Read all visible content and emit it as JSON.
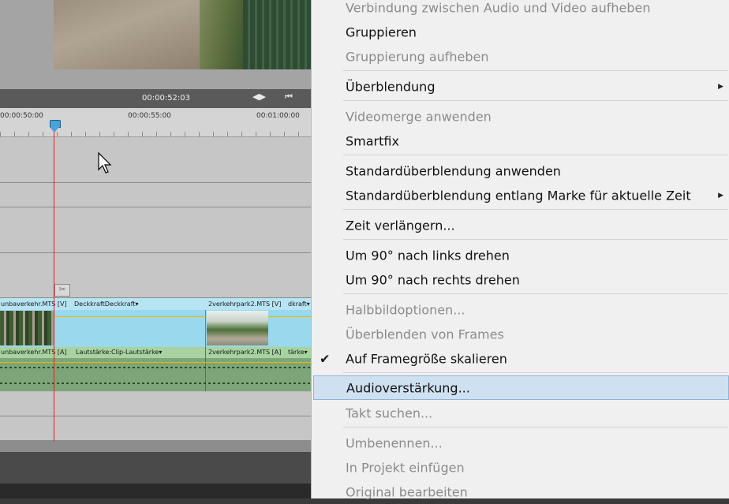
{
  "timeline": {
    "timecode": "00:00:52:03",
    "ruler_labels": [
      "00:00:50:00",
      "00:00:55:00",
      "00:01:00:00"
    ],
    "video_clip_1": "unbaverkehr.MTS [V]",
    "video_clip_1_effect": "DeckkraftDeckkraft▾",
    "video_clip_2": "2verkehrpark2.MTS [V]",
    "video_clip_2_effect": "dkraft▾",
    "audio_clip_1": "unbaverkehr.MTS [A]",
    "audio_clip_1_effect": "Lautstärke:Clip-Lautstärke▾",
    "audio_clip_2": "2verkehrpark2.MTS [A]",
    "audio_clip_2_effect": "tärke▾"
  },
  "menu": {
    "items": [
      {
        "label": "Verbindung zwischen Audio und Video aufheben",
        "disabled": true
      },
      {
        "label": "Gruppieren",
        "disabled": false
      },
      {
        "label": "Gruppierung aufheben",
        "disabled": true
      },
      {
        "label": "Überblendung",
        "disabled": false,
        "submenu": true
      },
      {
        "label": "Videomerge anwenden",
        "disabled": true
      },
      {
        "label": "Smartfix",
        "disabled": false
      },
      {
        "label": "Standardüberblendung anwenden",
        "disabled": false
      },
      {
        "label": "Standardüberblendung entlang Marke für aktuelle Zeit",
        "disabled": false,
        "submenu": true
      },
      {
        "label": "Zeit verlängern...",
        "disabled": false
      },
      {
        "label": "Um 90° nach links drehen",
        "disabled": false
      },
      {
        "label": "Um 90° nach rechts drehen",
        "disabled": false
      },
      {
        "label": "Halbbildoptionen...",
        "disabled": true
      },
      {
        "label": "Überblenden von Frames",
        "disabled": true
      },
      {
        "label": "Auf Framegröße skalieren",
        "disabled": false,
        "checked": true
      },
      {
        "label": "Audioverstärkung...",
        "disabled": false,
        "highlighted": true
      },
      {
        "label": "Takt suchen...",
        "disabled": true
      },
      {
        "label": "Umbenennen...",
        "disabled": true
      },
      {
        "label": "In Projekt einfügen",
        "disabled": true
      },
      {
        "label": "Original bearbeiten",
        "disabled": true
      }
    ]
  },
  "icons": {
    "submenu": "submenu-arrow-icon",
    "check": "checkmark-icon",
    "scissors": "scissors-icon"
  }
}
